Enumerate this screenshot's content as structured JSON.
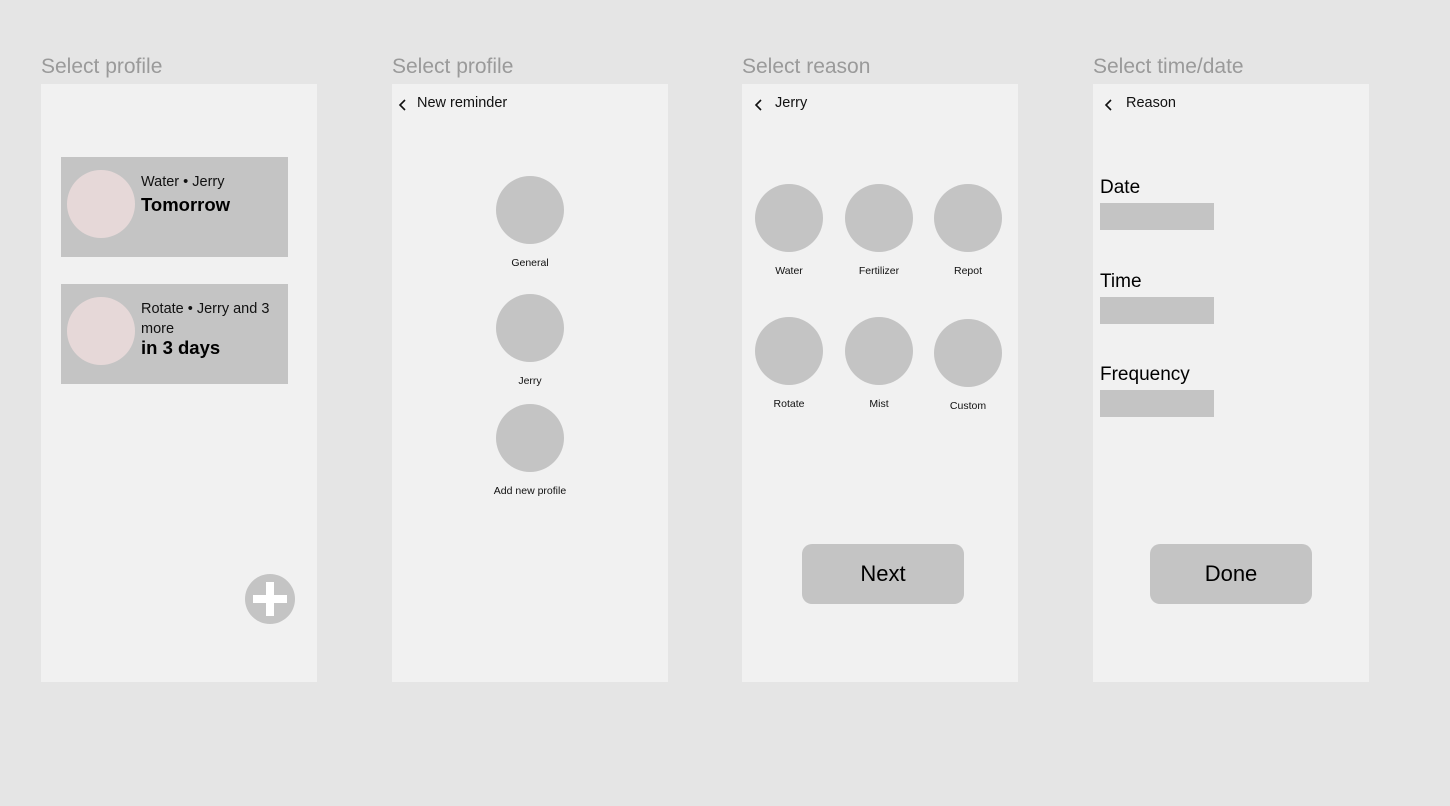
{
  "frames": [
    {
      "label": "Select profile",
      "reminders": [
        {
          "subtitle": "Water • Jerry",
          "when": "Tomorrow"
        },
        {
          "subtitle": "Rotate • Jerry and 3 more",
          "when": "in 3 days"
        }
      ],
      "fab_icon": "plus-icon"
    },
    {
      "label": "Select profile",
      "header_title": "New reminder",
      "options": [
        "General",
        "Jerry",
        "Add new profile"
      ]
    },
    {
      "label": "Select reason",
      "header_title": "Jerry",
      "options": [
        "Water",
        "Fertilizer",
        "Repot",
        "Rotate",
        "Mist",
        "Custom"
      ],
      "button_label": "Next"
    },
    {
      "label": "Select time/date",
      "header_title": "Reason",
      "fields": [
        {
          "label": "Date",
          "value": ""
        },
        {
          "label": "Time",
          "value": ""
        },
        {
          "label": "Frequency",
          "value": ""
        }
      ],
      "button_label": "Done"
    }
  ],
  "colors": {
    "background": "#e5e5e5",
    "frame": "#f1f1f1",
    "placeholder": "#c4c4c4",
    "avatar": "#e6d8d8",
    "label_gray": "#9a9a9a"
  }
}
